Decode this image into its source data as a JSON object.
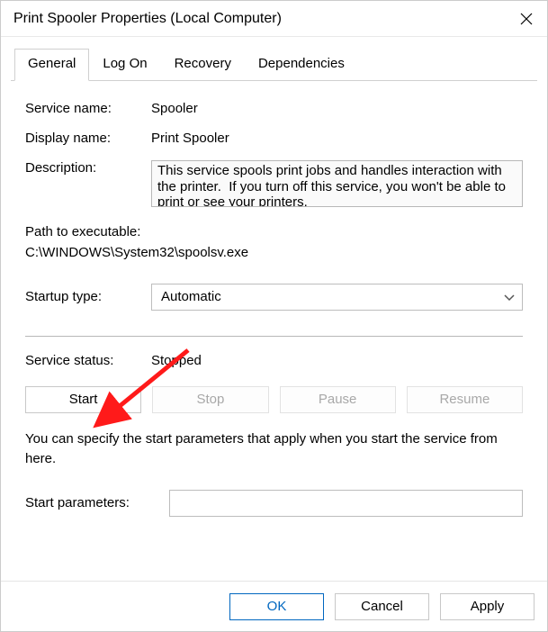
{
  "window": {
    "title": "Print Spooler Properties (Local Computer)"
  },
  "tabs": {
    "general": "General",
    "logon": "Log On",
    "recovery": "Recovery",
    "dependencies": "Dependencies"
  },
  "labels": {
    "service_name": "Service name:",
    "display_name": "Display name:",
    "description": "Description:",
    "path_label": "Path to executable:",
    "startup_type": "Startup type:",
    "service_status": "Service status:",
    "note": "You can specify the start parameters that apply when you start the service from here.",
    "start_parameters": "Start parameters:"
  },
  "values": {
    "service_name": "Spooler",
    "display_name": "Print Spooler",
    "description": "This service spools print jobs and handles interaction with the printer.  If you turn off this service, you won't be able to print or see your printers.",
    "path": "C:\\WINDOWS\\System32\\spoolsv.exe",
    "startup_type": "Automatic",
    "service_status": "Stopped",
    "start_parameters": ""
  },
  "buttons": {
    "start": "Start",
    "stop": "Stop",
    "pause": "Pause",
    "resume": "Resume",
    "ok": "OK",
    "cancel": "Cancel",
    "apply": "Apply"
  }
}
